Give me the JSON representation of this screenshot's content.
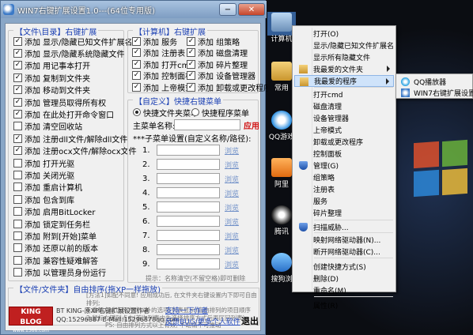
{
  "window": {
    "title": "WIN7右键扩展设置1.0---(64位专用版)",
    "min_label": "−",
    "close_label": "✕"
  },
  "file_dir_group": {
    "title": "【文件\\目录】右键扩展",
    "items": [
      {
        "label": "添加 显示/隐藏已知文件扩展名",
        "checked": true
      },
      {
        "label": "添加 显示/隐藏系统隐藏文件",
        "checked": true
      },
      {
        "label": "添加 用记事本打开",
        "checked": true
      },
      {
        "label": "添加 复制到文件夹",
        "checked": true
      },
      {
        "label": "添加 移动到文件夹",
        "checked": true
      },
      {
        "label": "添加 管理员取得所有权",
        "checked": true
      },
      {
        "label": "添加 在此处打开命令窗口",
        "checked": true
      },
      {
        "label": "添加 清空回收站",
        "checked": false
      },
      {
        "label": "添加 注册dll文件/解除dll文件",
        "checked": true
      },
      {
        "label": "添加 注册ocx文件/解除ocx文件",
        "checked": true
      },
      {
        "label": "添加 打开光驱",
        "checked": false
      },
      {
        "label": "添加 关闭光驱",
        "checked": false
      },
      {
        "label": "添加 重启计算机",
        "checked": false
      },
      {
        "label": "添加 包含到库",
        "checked": false
      },
      {
        "label": "添加 启用BitLocker",
        "checked": false
      },
      {
        "label": "添加 锁定到任务栏",
        "checked": false
      },
      {
        "label": "添加 附到[开始]菜单",
        "checked": false
      },
      {
        "label": "添加 还原以前的版本",
        "checked": false
      },
      {
        "label": "添加 兼容性疑难解答",
        "checked": false
      },
      {
        "label": "添加 以管理员身份运行",
        "checked": false
      }
    ]
  },
  "computer_group": {
    "title": "【计算机】右键扩展",
    "items": [
      {
        "label": "添加 服务",
        "checked": true
      },
      {
        "label": "添加 组策略",
        "checked": true
      },
      {
        "label": "添加 注册表",
        "checked": true
      },
      {
        "label": "添加 磁盘清理",
        "checked": true
      },
      {
        "label": "添加 打开cmd",
        "checked": true
      },
      {
        "label": "添加 碎片整理",
        "checked": true
      },
      {
        "label": "添加 控制面板",
        "checked": true
      },
      {
        "label": "添加 设备管理器",
        "checked": true
      },
      {
        "label": "添加 上帝模式",
        "checked": true
      },
      {
        "label": "添加 卸载或更改程序",
        "checked": true
      }
    ]
  },
  "custom_group": {
    "title": "【自定义】快捷右键菜单",
    "radio1": "快捷文件夹菜单",
    "radio2": "快捷程序菜单",
    "main_menu_label": "主菜单名称:",
    "apply": "应用",
    "sub_header": "***子菜单设置(自定义名称/路径):",
    "rows": [
      "1.",
      "2.",
      "3.",
      "4.",
      "5.",
      "6.",
      "7.",
      "8.",
      "9."
    ],
    "browse": "浏览",
    "hint": "提示：名称清空(不留空格)即可删除"
  },
  "autorun_group": {
    "title": "【文件/文件夹】自由排序(拖XP一样拖放)",
    "apply": "应用",
    "line1": "[方法1]如配不同意! 应用成功后, 在文件夹右键设置内下即可自由排列;",
    "line2": "1.重新方式选择方式以外的选项(列表显示)自由排列的项目顺序",
    "line3": "2.鼠标右键列点击(首次列表内先选择排序方式后再区回列表)",
    "line4": "PS: 自由排列方式以上有效, 不动请不可推动"
  },
  "footer": {
    "logo_top": "KING BLOG",
    "logo_sub": "www.1366.com",
    "author_line": "BT KING-原XP右键扩展设置作者",
    "contact": "QQ:15296887 E-Mail:15296878qq.com",
    "support": "支持一下作者",
    "feedback": "反馈BUG/更多个人软件",
    "exit": "退出"
  },
  "desktop": {
    "icons": [
      "计算机",
      "常用",
      "QQ游戏",
      "阿里",
      "腾讯",
      "搜狗浏"
    ]
  },
  "context_menu": {
    "items": [
      "打开(O)",
      "显示/隐藏已知文件扩展名",
      "显示所有隐藏文件",
      "我最爱的文件夹",
      "我最爱的程序",
      "打开cmd",
      "磁盘清理",
      "设备管理器",
      "上帝模式",
      "卸载或更改程序",
      "控制面板",
      "管理(G)",
      "组策略",
      "注册表",
      "服务",
      "碎片整理",
      "扫描威胁...",
      "映射网络驱动器(N)...",
      "断开网络驱动器(C)...",
      "创建快捷方式(S)",
      "删除(D)",
      "重命名(M)",
      "属性(R)"
    ]
  },
  "submenu": {
    "items": [
      "QQ播放器",
      "WIN7右键扩展设置"
    ]
  },
  "colors": {
    "group_title": "#1a3fb3",
    "apply_red": "#d01010",
    "menu_highlight": "#cfe3fa"
  }
}
